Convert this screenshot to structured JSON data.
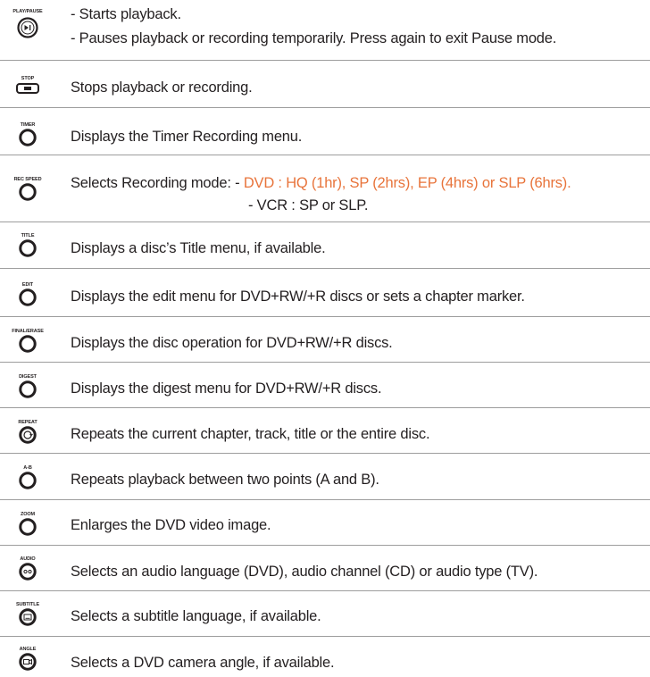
{
  "accent_color": "#e8743b",
  "rows": [
    {
      "icon_label": "PLAY/PAUSE",
      "icon": "play-pause-icon",
      "lines": [
        "- Starts playback.",
        "- Pauses playback or recording temporarily. Press again to exit Pause mode."
      ]
    },
    {
      "icon_label": "STOP",
      "icon": "stop-icon",
      "text": "Stops playback or recording."
    },
    {
      "icon_label": "TIMER",
      "icon": "round-button-icon",
      "text": "Displays the Timer Recording menu."
    },
    {
      "icon_label": "REC SPEED",
      "icon": "round-button-icon",
      "text_prefix": "Selects Recording mode: - ",
      "text_accent": "DVD : HQ (1hr), SP (2hrs), EP (4hrs) or SLP (6hrs).",
      "text_line2": "- VCR : SP or SLP."
    },
    {
      "icon_label": "TITLE",
      "icon": "round-button-icon",
      "text": "Displays a disc’s Title menu, if available."
    },
    {
      "icon_label": "EDIT",
      "icon": "round-button-icon",
      "text": "Displays the edit menu for DVD+RW/+R discs or sets a chapter marker."
    },
    {
      "icon_label": "FINAL/ERASE",
      "icon": "round-button-icon",
      "text": "Displays the disc operation for DVD+RW/+R discs."
    },
    {
      "icon_label": "DIGEST",
      "icon": "round-button-icon",
      "text": "Displays the digest menu for DVD+RW/+R discs."
    },
    {
      "icon_label": "REPEAT",
      "icon": "repeat-icon",
      "text": "Repeats the current chapter, track, title or the entire disc."
    },
    {
      "icon_label": "A-B",
      "icon": "round-button-icon",
      "text": "Repeats playback between two points (A and B)."
    },
    {
      "icon_label": "ZOOM",
      "icon": "round-button-icon",
      "text": "Enlarges the DVD video image."
    },
    {
      "icon_label": "AUDIO",
      "icon": "audio-icon",
      "text": "Selects an audio language (DVD), audio channel (CD) or audio type (TV)."
    },
    {
      "icon_label": "SUBTITLE",
      "icon": "subtitle-icon",
      "text": "Selects a subtitle language, if available."
    },
    {
      "icon_label": "ANGLE",
      "icon": "angle-icon",
      "text": "Selects a DVD camera angle, if available."
    }
  ]
}
